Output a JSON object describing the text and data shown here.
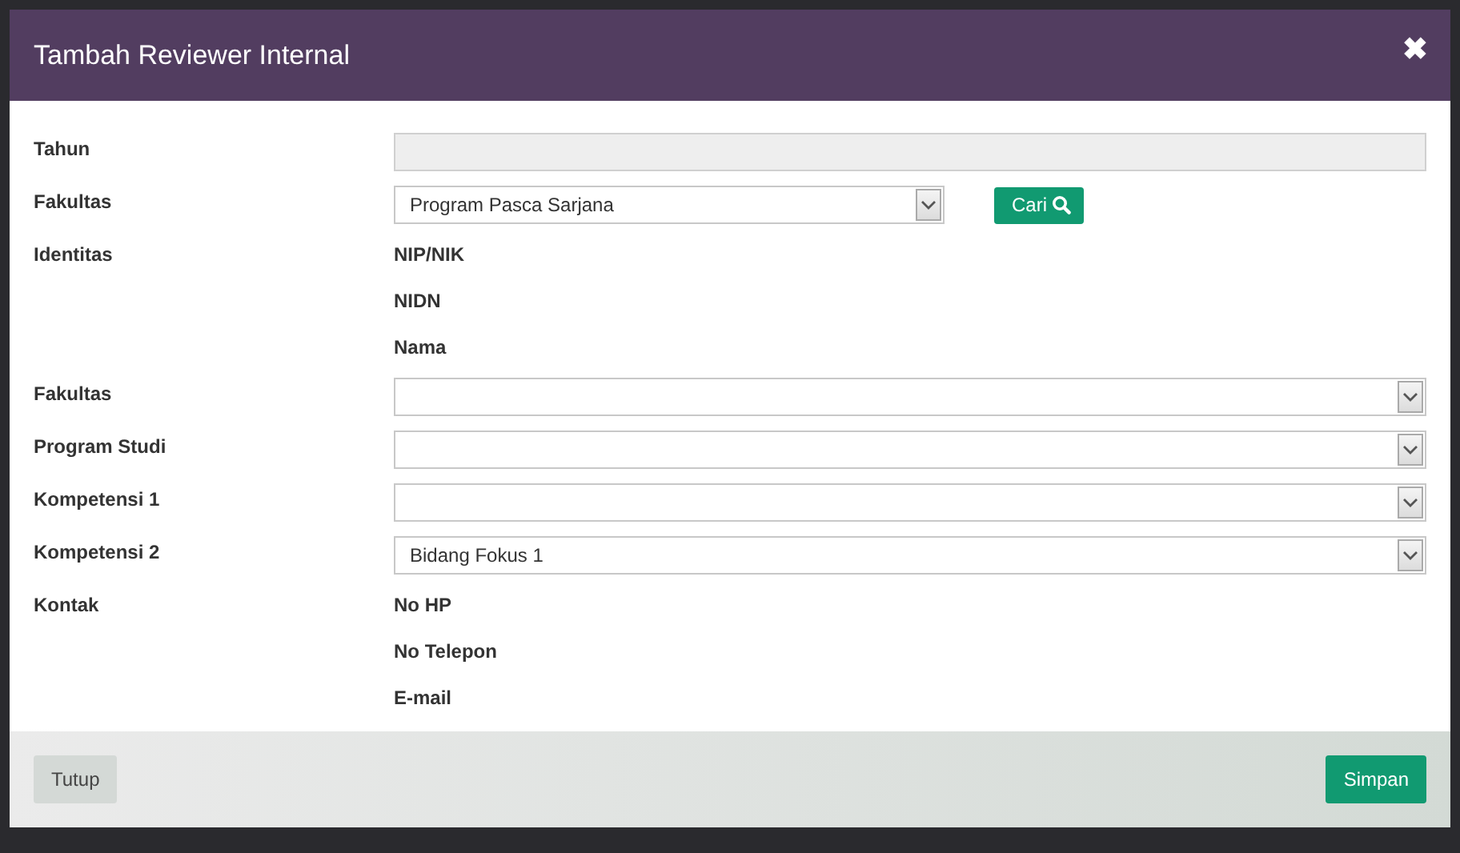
{
  "modal": {
    "title": "Tambah Reviewer Internal",
    "close": "✖"
  },
  "rows": [
    {
      "kind": "input",
      "label": "Tahun",
      "disabled": true
    },
    {
      "kind": "select",
      "label": "Fakultas",
      "value": "Program Pasca Sarjana",
      "button": "Cari"
    },
    {
      "kind": "info",
      "label": "Identitas",
      "lines": [
        "NIP/NIK",
        "NIDN",
        "Nama"
      ]
    },
    {
      "kind": "select",
      "label": "Fakultas",
      "value": ""
    },
    {
      "kind": "select",
      "label": "Program Studi",
      "value": ""
    },
    {
      "kind": "select",
      "label": "Kompetensi 1",
      "value": ""
    },
    {
      "kind": "select",
      "label": "Kompetensi 2",
      "value": "Bidang Fokus 1"
    },
    {
      "kind": "info",
      "label": "Kontak",
      "lines": [
        "No HP",
        "No Telepon",
        "E-mail"
      ]
    }
  ],
  "footer": {
    "close_button": "Tutup",
    "save_button": "Simpan"
  }
}
